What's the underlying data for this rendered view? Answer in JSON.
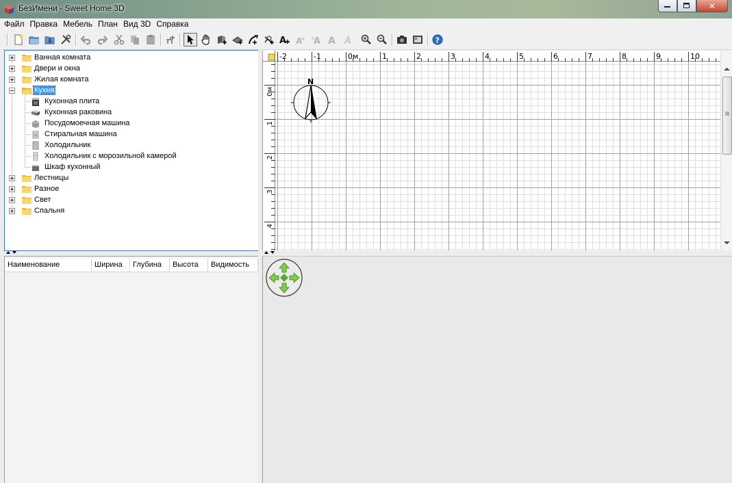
{
  "window": {
    "title": "БезИмени - Sweet Home 3D",
    "minimize_label": "",
    "maximize_label": "",
    "close_label": "✕"
  },
  "menu": [
    "Файл",
    "Правка",
    "Мебель",
    "План",
    "Вид 3D",
    "Справка"
  ],
  "toolbar": {
    "icons": [
      "new-file-icon",
      "open-icon",
      "save-icon",
      "preferences-icon",
      "undo-icon",
      "redo-icon",
      "cut-icon",
      "copy-icon",
      "paste-icon",
      "add-furniture-icon",
      "select-mode-icon",
      "pan-mode-icon",
      "create-walls-icon",
      "create-rooms-icon",
      "create-dimensions-icon",
      "create-polylines-icon",
      "add-text-icon",
      "increase-text-icon",
      "decrease-text-icon",
      "bold-text-icon",
      "italic-text-icon",
      "zoom-in-icon",
      "zoom-out-icon",
      "create-photo-icon",
      "create-video-icon",
      "help-icon"
    ]
  },
  "catalog": {
    "categories": [
      {
        "label": "Ванная комната",
        "expanded": false
      },
      {
        "label": "Двери и окна",
        "expanded": false
      },
      {
        "label": "Жилая комната",
        "expanded": false
      },
      {
        "label": "Кухня",
        "expanded": true,
        "selected": true,
        "items": [
          "Кухонная плита",
          "Кухонная раковина",
          "Посудомоечная машина",
          "Стиральная машина",
          "Холодильник",
          "Холодильник с морозильной камерой",
          "Шкаф кухонный"
        ]
      },
      {
        "label": "Лестницы",
        "expanded": false
      },
      {
        "label": "Разное",
        "expanded": false
      },
      {
        "label": "Свет",
        "expanded": false
      },
      {
        "label": "Спальня",
        "expanded": false
      }
    ]
  },
  "furniture_table": {
    "columns": [
      "Наименование",
      "Ширина",
      "Глубина",
      "Высота",
      "Видимость"
    ]
  },
  "plan": {
    "ruler_x": [
      "-2",
      "-1",
      "0м",
      "1",
      "2",
      "3",
      "4",
      "5",
      "6",
      "7",
      "8",
      "9",
      "10"
    ],
    "ruler_y": [
      "0м",
      "1",
      "2",
      "3",
      "4"
    ],
    "compass_label": "N"
  },
  "colors": {
    "selection": "#3399ff",
    "grid_major": "#a0a0a0",
    "grid_minor": "#dedede",
    "nav_green": "#6fbf3a"
  }
}
